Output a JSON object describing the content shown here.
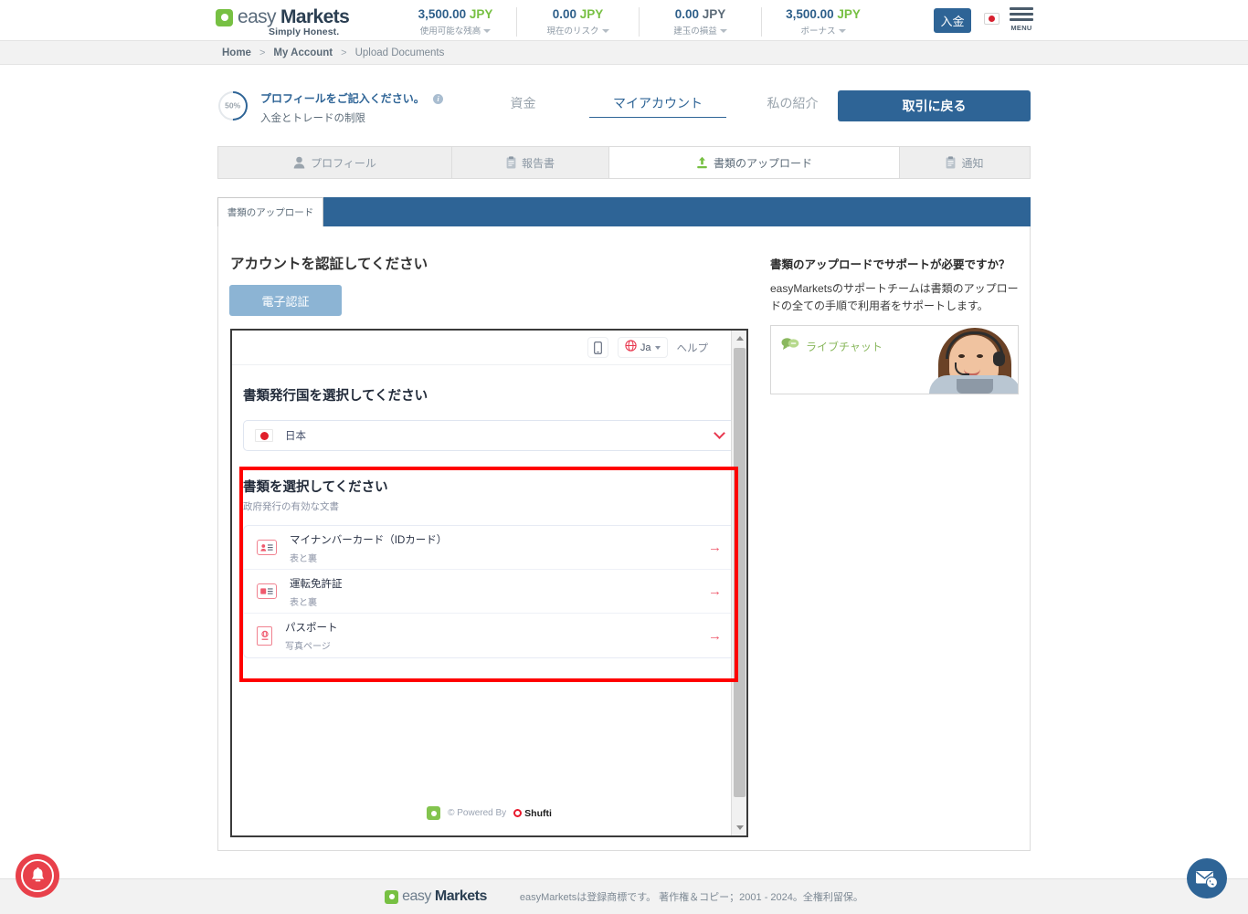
{
  "header": {
    "logo": {
      "easy": "easy",
      "markets": "Markets",
      "tagline": "Simply Honest."
    },
    "stats": [
      {
        "value": "3,500.00",
        "currency": "JPY",
        "label": "使用可能な残高"
      },
      {
        "value": "0.00",
        "currency": "JPY",
        "label": "現在のリスク"
      },
      {
        "value": "0.00",
        "currency": "JPY",
        "label": "建玉の損益"
      },
      {
        "value": "3,500.00",
        "currency": "JPY",
        "label": "ボーナス"
      }
    ],
    "deposit_label": "入金",
    "menu_label": "MENU",
    "flag": "japan-flag"
  },
  "breadcrumb": {
    "items": [
      "Home",
      "My Account",
      "Upload Documents"
    ],
    "separator": ">"
  },
  "profile": {
    "progress": "50%",
    "title": "プロフィールをご記入ください。",
    "subtitle": "入金とトレードの制限"
  },
  "nav": {
    "tabs": [
      {
        "label": "資金",
        "active": false
      },
      {
        "label": "マイアカウント",
        "active": true
      },
      {
        "label": "私の紹介",
        "active": false
      }
    ],
    "back_to_trading": "取引に戻る"
  },
  "tabstrip": [
    {
      "label": "プロフィール",
      "icon": "person-icon",
      "active": false
    },
    {
      "label": "報告書",
      "icon": "clipboard-icon",
      "active": false
    },
    {
      "label": "書類のアップロード",
      "icon": "upload-icon",
      "active": true
    },
    {
      "label": "通知",
      "icon": "clipboard-icon",
      "active": false
    }
  ],
  "subtab": {
    "label": "書類のアップロード"
  },
  "main": {
    "verify_heading": "アカウントを認証してください",
    "eauth_button": "電子認証"
  },
  "iframe": {
    "toolbar": {
      "phone_icon": "phone-icon",
      "globe_icon": "globe-icon",
      "language": "Ja",
      "help": "ヘルプ"
    },
    "country_heading": "書類発行国を選択してください",
    "country_value": "日本",
    "doc_heading": "書類を選択してください",
    "doc_subheading": "政府発行の有効な文書",
    "documents": [
      {
        "title": "マイナンバーカード（IDカード）",
        "subtitle": "表と裏",
        "icon": "id-card-icon"
      },
      {
        "title": "運転免許証",
        "subtitle": "表と裏",
        "icon": "drivers-license-icon"
      },
      {
        "title": "パスポート",
        "subtitle": "写真ページ",
        "icon": "passport-icon"
      }
    ],
    "footer": {
      "powered_by": "© Powered By",
      "provider": "Shufti"
    }
  },
  "sidebar": {
    "heading": "書類のアップロードでサポートが必要ですか？",
    "body": "easyMarketsのサポートチームは書類のアップロードの全ての手順で利用者をサポートします。",
    "live_chat": "ライブチャット"
  },
  "footer": {
    "logo_easy": "easy",
    "logo_markets": "Markets",
    "copyright": "easyMarketsは登録商標です。 著作権＆コピー；2001 - 2024。全権利留保。"
  },
  "fabs": {
    "bell": "notification-bell",
    "chat": "contact-chat"
  },
  "colors": {
    "brand_blue": "#2e6496",
    "brand_green": "#77c043",
    "highlight_red": "#ff0000",
    "accent_pink": "#ef5a6e"
  }
}
